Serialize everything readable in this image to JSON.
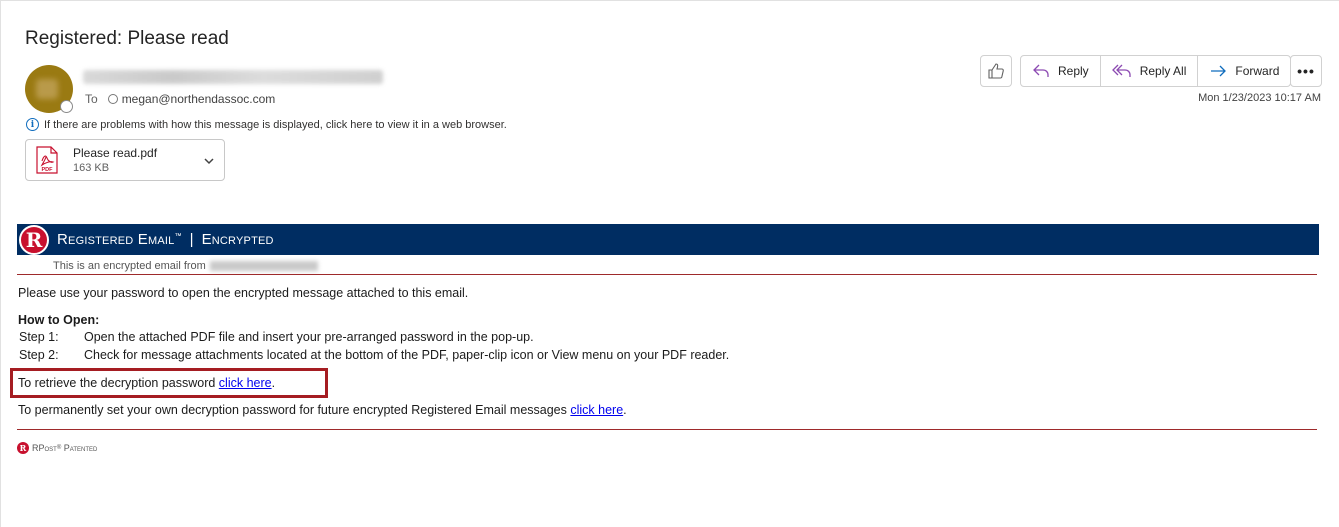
{
  "email": {
    "subject": "Registered: Please read",
    "to_label": "To",
    "recipient": "megan@northendassoc.com",
    "info_text": "If there are problems with how this message is displayed, click here to view it in a web browser.",
    "datetime": "Mon 1/23/2023 10:17 AM"
  },
  "attachment": {
    "name": "Please read.pdf",
    "size": "163 KB",
    "icon_label": "PDF"
  },
  "actions": {
    "reply": "Reply",
    "reply_all": "Reply All",
    "forward": "Forward",
    "more": "•••"
  },
  "message": {
    "banner_left": "Registered Email",
    "banner_tm": "™",
    "banner_sep": "|",
    "banner_right": "Encrypted",
    "logo_letter": "R",
    "from_prefix": "This is an encrypted email from",
    "intro": "Please use your password to open the encrypted message attached to this email.",
    "howto_title": "How to Open:",
    "steps": [
      {
        "num": "Step 1:",
        "text": "Open the attached PDF file and insert your pre-arranged password in the pop-up."
      },
      {
        "num": "Step 2:",
        "text": "Check for message attachments located at the bottom of the PDF, paper-clip icon or View menu on your PDF reader."
      }
    ],
    "retrieve_prefix": "To retrieve the decryption password ",
    "retrieve_link": "click here",
    "retrieve_suffix": ".",
    "permanent_prefix": "To permanently set your own decryption password for future encrypted Registered Email messages ",
    "permanent_link": "click here",
    "permanent_suffix": ".",
    "footer_brand": "RPost",
    "footer_reg": "®",
    "footer_patented": "Patented"
  },
  "colors": {
    "banner_bg": "#002d62",
    "brand_red": "#c8102e",
    "highlight_border": "#a51d22",
    "rule": "#9e2a2b",
    "link": "#0000ee"
  }
}
